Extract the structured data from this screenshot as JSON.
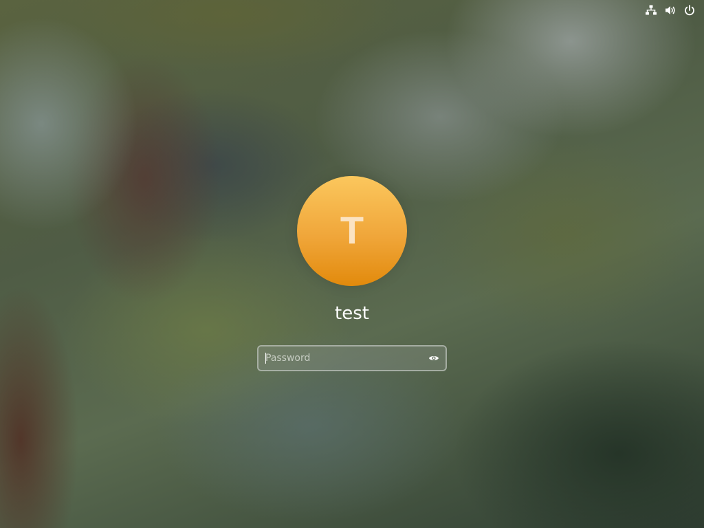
{
  "wallpaper": {
    "style": "blurred-nature",
    "dominant_colors": [
      "#5a6340",
      "#4f5c45",
      "#2f3e32",
      "#969e9b"
    ]
  },
  "top_bar": {
    "icons": [
      {
        "name": "network-wired-icon"
      },
      {
        "name": "volume-icon"
      },
      {
        "name": "power-icon"
      }
    ]
  },
  "user": {
    "avatar_letter": "T",
    "avatar_color": "#f0a63a",
    "name": "test"
  },
  "password": {
    "placeholder": "Password",
    "value": "",
    "reveal_icon": "eye-icon"
  }
}
